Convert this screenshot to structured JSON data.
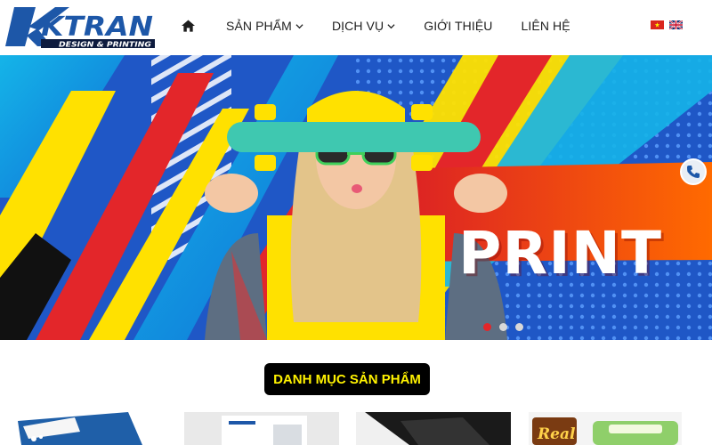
{
  "brand": {
    "name": "KTRAN",
    "tagline": "DESIGN & PRINTING",
    "colors": {
      "primary": "#1d57a8",
      "dark": "#0d1b3e"
    }
  },
  "nav": {
    "home_icon": "home-icon",
    "items": [
      {
        "label": "SẢN PHẨM",
        "has_dropdown": true
      },
      {
        "label": "DỊCH VỤ",
        "has_dropdown": true
      },
      {
        "label": "GIỚI THIỆU",
        "has_dropdown": false
      },
      {
        "label": "LIÊN HỆ",
        "has_dropdown": false
      }
    ],
    "languages": [
      "vi",
      "en"
    ]
  },
  "banner": {
    "headline": "PRINT",
    "slides_total": 3,
    "active_slide": 1,
    "phone_icon": "phone-icon",
    "colors": {
      "blue": "#1f57c6",
      "yellow": "#ffe100",
      "red": "#e3262a",
      "cyan": "#15b4e8"
    }
  },
  "categories": {
    "title": "DANH MỤC SẢN PHẨM",
    "title_color": "#fff200"
  }
}
